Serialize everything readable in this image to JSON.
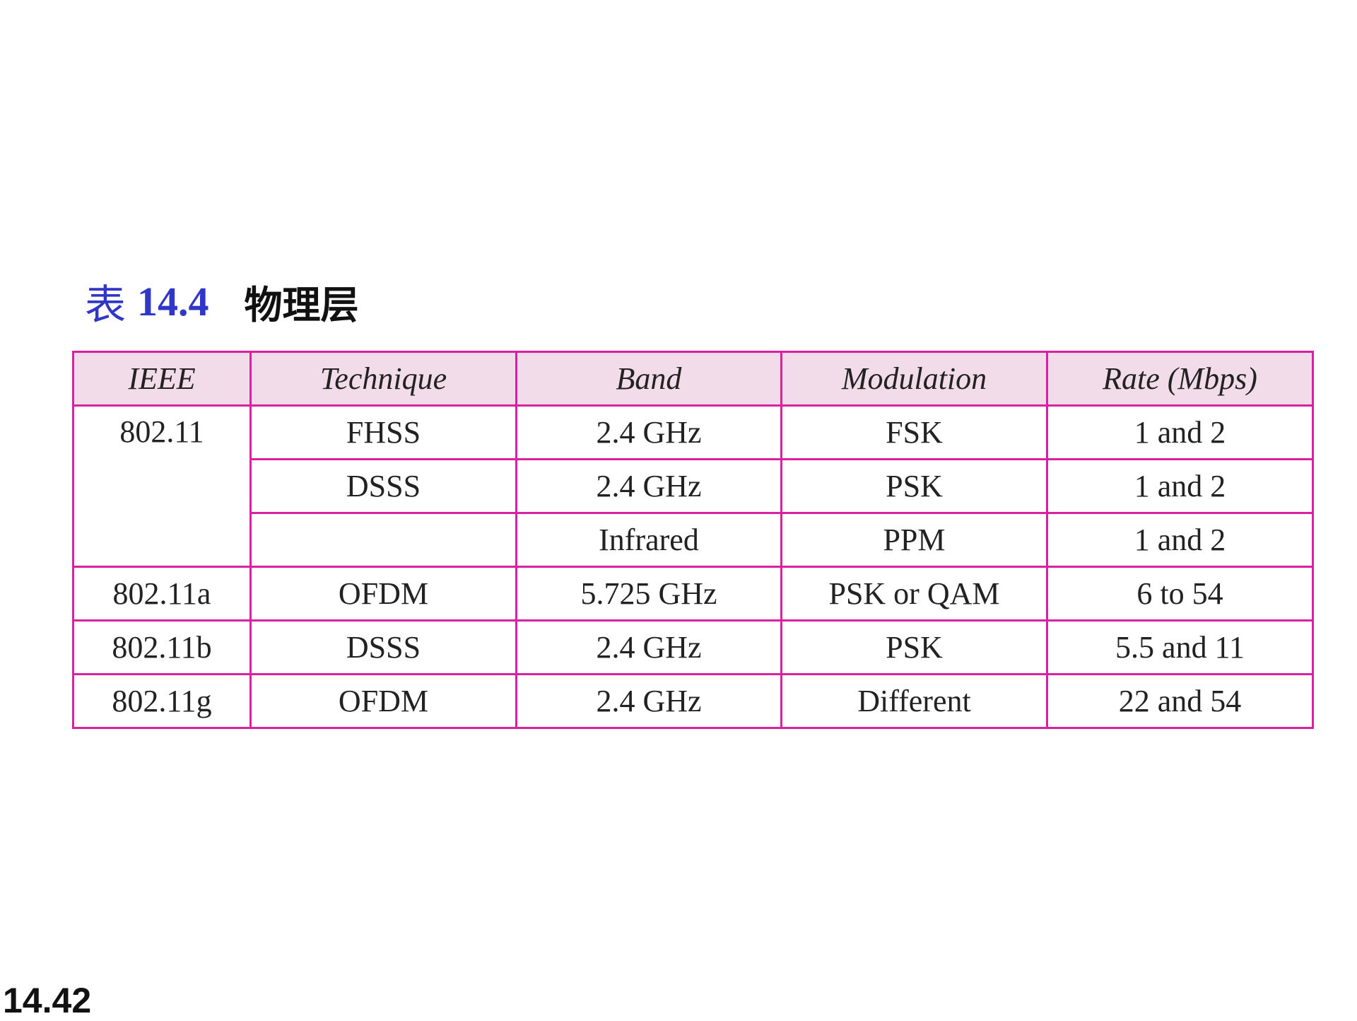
{
  "caption": {
    "label": "表",
    "number": "14.4",
    "title": "物理层"
  },
  "table": {
    "headers": [
      "IEEE",
      "Technique",
      "Band",
      "Modulation",
      "Rate (Mbps)"
    ],
    "rows": [
      {
        "ieee": "802.11",
        "technique": "FHSS",
        "band": "2.4 GHz",
        "modulation": "FSK",
        "rate": "1 and 2"
      },
      {
        "ieee": "",
        "technique": "DSSS",
        "band": "2.4 GHz",
        "modulation": "PSK",
        "rate": "1 and 2"
      },
      {
        "ieee": "",
        "technique": "",
        "band": "Infrared",
        "modulation": "PPM",
        "rate": "1 and 2"
      },
      {
        "ieee": "802.11a",
        "technique": "OFDM",
        "band": "5.725 GHz",
        "modulation": "PSK or QAM",
        "rate": "6 to 54"
      },
      {
        "ieee": "802.11b",
        "technique": "DSSS",
        "band": "2.4 GHz",
        "modulation": "PSK",
        "rate": "5.5 and 11"
      },
      {
        "ieee": "802.11g",
        "technique": "OFDM",
        "band": "2.4 GHz",
        "modulation": "Different",
        "rate": "22 and 54"
      }
    ]
  },
  "page_number": "14.42",
  "colors": {
    "caption_accent": "#2f36c8",
    "table_border": "#d9219f",
    "header_background": "#f2dcea"
  }
}
